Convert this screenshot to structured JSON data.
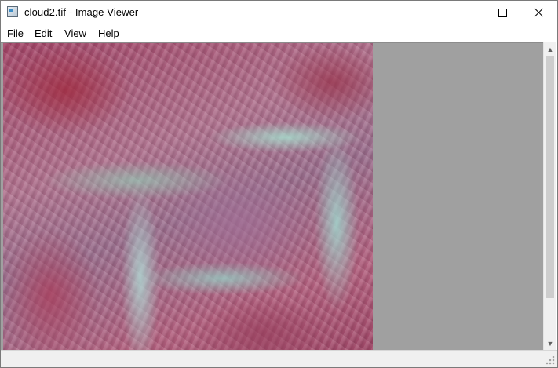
{
  "window": {
    "title": "cloud2.tif - Image Viewer",
    "controls": {
      "minimize_icon": "minimize-icon",
      "maximize_icon": "maximize-icon",
      "close_icon": "close-icon"
    }
  },
  "menu": {
    "items": [
      {
        "mnemonic": "F",
        "rest": "ile"
      },
      {
        "mnemonic": "E",
        "rest": "dit"
      },
      {
        "mnemonic": "V",
        "rest": "iew"
      },
      {
        "mnemonic": "H",
        "rest": "elp"
      }
    ]
  },
  "image": {
    "name": "cloud2.tif",
    "icon": "satellite-image"
  },
  "scrollbar": {
    "up_glyph": "▲",
    "down_glyph": "▼"
  },
  "colors": {
    "viewport_background": "#a0a0a0",
    "scrollbar_track": "#f0f0f0",
    "scrollbar_thumb": "#cdcdcd"
  }
}
